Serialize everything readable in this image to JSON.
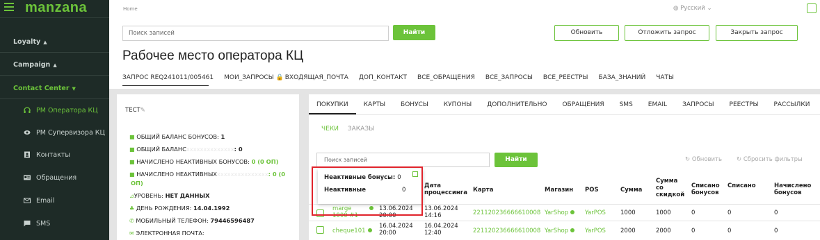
{
  "brand": {
    "logo": "manzana",
    "accent": "#6cc33a",
    "sidebar_bg": "#1e2b27",
    "highlight": "#e0232b"
  },
  "header": {
    "breadcrumb": "Home",
    "language": "Русский"
  },
  "sidebar": {
    "groups": [
      {
        "label": "Loyalty",
        "caret": "▲"
      },
      {
        "label": "Campaign",
        "caret": "▲"
      },
      {
        "label": "Contact Center",
        "caret": "▼"
      }
    ],
    "items": [
      {
        "label": "РМ Оператора КЦ",
        "icon": "headset-icon"
      },
      {
        "label": "РМ Супервизора КЦ",
        "icon": "eye-icon"
      },
      {
        "label": "Контакты",
        "icon": "contact-card-icon"
      },
      {
        "label": "Обращения",
        "icon": "id-card-icon"
      },
      {
        "label": "Email",
        "icon": "envelope-icon"
      },
      {
        "label": "SMS",
        "icon": "chat-icon"
      }
    ]
  },
  "search_top": {
    "placeholder": "Поиск записей",
    "button": "Найти"
  },
  "actions": {
    "refresh": "Обновить",
    "postpone": "Отложить запрос",
    "close": "Закрыть запрос"
  },
  "page_title": "Рабочее место оператора КЦ",
  "top_tabs": [
    "ЗАПРОС REQ241011/005461",
    "МОИ_ЗАПРОСЫ",
    "ВХОДЯЩАЯ_ПОЧТА",
    "ДОП_КОНТАКТ",
    "ВСЕ_ОБРАЩЕНИЯ",
    "ВСЕ_ЗАПРОСЫ",
    "ВСЕ_РЕЕСТРЫ",
    "БАЗА_ЗНАНИЙ",
    "ЧАТЫ"
  ],
  "client": {
    "name": "ТЕСТ",
    "total_balance_label": "ОБЩИЙ БАЛАНС БОНУСОВ:",
    "total_balance": "1",
    "total_balance2_label": "ОБЩИЙ БАЛАНС",
    "total_balance2": ": 0",
    "inactive_accrued_label": "НАЧИСЛЕНО НЕАКТИВНЫХ БОНУСОВ:",
    "inactive_accrued": "0 (0 ОП)",
    "inactive_accrued2_label": "НАЧИСЛЕНО НЕАКТИВНЫХ",
    "inactive_accrued2": ": 0 (0",
    "inactive_accrued2_cont": "ОП)",
    "level_label": "УРОВЕНЬ:",
    "level": "НЕТ ДАННЫХ",
    "birthday_label": "ДЕНЬ РОЖДЕНИЯ:",
    "birthday": "14.04.1992",
    "phone_label": "МОБИЛЬНЫЙ ТЕЛЕФОН:",
    "phone": "79446596487",
    "email_label": "ЭЛЕКТРОННАЯ ПОЧТА:"
  },
  "main_tabs": [
    "ПОКУПКИ",
    "КАРТЫ",
    "БОНУСЫ",
    "КУПОНЫ",
    "ДОПОЛНИТЕЛЬНО",
    "ОБРАЩЕНИЯ",
    "SMS",
    "EMAIL",
    "ЗАПРОСЫ",
    "РЕЕСТРЫ",
    "РАССЫЛКИ"
  ],
  "sub_tabs": [
    "ЧЕКИ",
    "ЗАКАЗЫ"
  ],
  "search_main": {
    "placeholder": "Поиск записей",
    "button": "Найти",
    "refresh": "Обновить",
    "reset": "Сбросить фильтры"
  },
  "table": {
    "headers": {
      "processing_date": "Дата процессинга",
      "card": "Карта",
      "shop": "Магазин",
      "pos": "POS",
      "sum": "Сумма",
      "sum_discount": "Сумма со скидкой",
      "written_bonus": "Списано бонусов",
      "written": "Списано",
      "accrued": "Начислено бонусов"
    },
    "rows": [
      {
        "id": "marge 1000 #1",
        "date": "13.06.2024 20:00",
        "processing": "13.06.2024 14:16",
        "card": "221120236666610008",
        "shop": "YarShop",
        "pos": "YarPOS",
        "sum": "1000",
        "sum_discount": "1000",
        "written_bonus": "0",
        "written": "0",
        "accrued": "0"
      },
      {
        "id": "cheque101",
        "date": "16.04.2024 20:00",
        "processing": "16.04.2024 12:40",
        "card": "221120236666610008",
        "shop": "YarShop",
        "pos": "YarPOS",
        "sum": "2000",
        "sum_discount": "2000",
        "written_bonus": "0",
        "written": "0",
        "accrued": "0"
      }
    ]
  },
  "popover": {
    "inactive_label": "Неактивные бонусы:",
    "inactive_value": "0",
    "inactive2_label": "Неактивные",
    "inactive2_value": "0"
  }
}
